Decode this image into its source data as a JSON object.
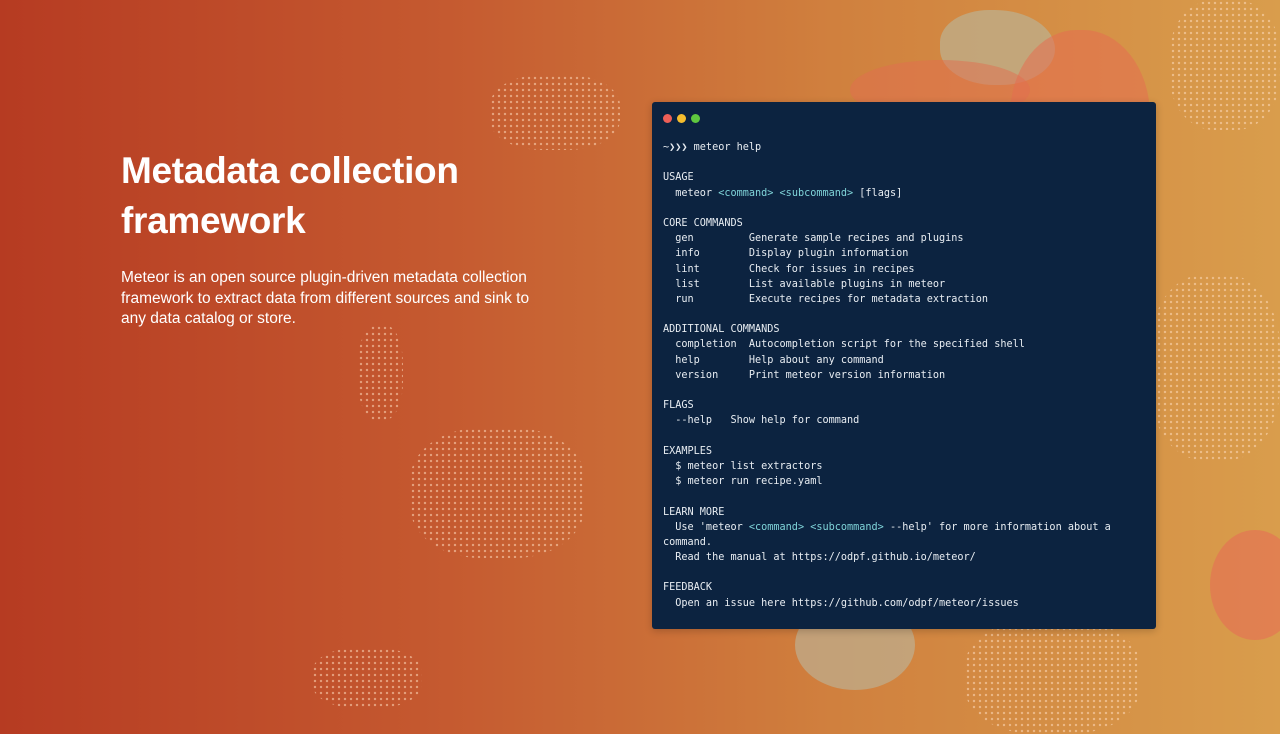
{
  "hero": {
    "title": "Metadata collection framework",
    "description": "Meteor is an open source plugin-driven metadata collection framework to extract data from different sources and sink to any data catalog or store."
  },
  "terminal": {
    "colors": {
      "red": "#ee5f57",
      "yellow": "#f5bd2e",
      "green": "#5fc73f",
      "background": "#0c2340",
      "highlight": "#7fd3d8"
    },
    "lines": [
      [
        {
          "t": "~❯❯❯ meteor help"
        }
      ],
      [],
      [
        {
          "t": "USAGE"
        }
      ],
      [
        {
          "t": "  meteor "
        },
        {
          "t": "<command>",
          "hl": true
        },
        {
          "t": " "
        },
        {
          "t": "<subcommand>",
          "hl": true
        },
        {
          "t": " [flags]"
        }
      ],
      [],
      [
        {
          "t": "CORE COMMANDS"
        }
      ],
      [
        {
          "t": "  gen         Generate sample recipes and plugins"
        }
      ],
      [
        {
          "t": "  info        Display plugin information"
        }
      ],
      [
        {
          "t": "  lint        Check for issues in recipes"
        }
      ],
      [
        {
          "t": "  list        List available plugins in meteor"
        }
      ],
      [
        {
          "t": "  run         Execute recipes for metadata extraction"
        }
      ],
      [],
      [
        {
          "t": "ADDITIONAL COMMANDS"
        }
      ],
      [
        {
          "t": "  completion  Autocompletion script for the specified shell"
        }
      ],
      [
        {
          "t": "  help        Help about any command"
        }
      ],
      [
        {
          "t": "  version     Print meteor version information"
        }
      ],
      [],
      [
        {
          "t": "FLAGS"
        }
      ],
      [
        {
          "t": "  --help   Show help for command"
        }
      ],
      [],
      [
        {
          "t": "EXAMPLES"
        }
      ],
      [
        {
          "t": "  $ meteor list extractors"
        }
      ],
      [
        {
          "t": "  $ meteor run recipe.yaml"
        }
      ],
      [],
      [
        {
          "t": "LEARN MORE"
        }
      ],
      [
        {
          "t": "  Use 'meteor "
        },
        {
          "t": "<command>",
          "hl": true
        },
        {
          "t": " "
        },
        {
          "t": "<subcommand>",
          "hl": true
        },
        {
          "t": " --help' for more information about a"
        }
      ],
      [
        {
          "t": "command."
        }
      ],
      [
        {
          "t": "  Read the manual at https://odpf.github.io/meteor/"
        }
      ],
      [],
      [
        {
          "t": "FEEDBACK"
        }
      ],
      [
        {
          "t": "  Open an issue here https://github.com/odpf/meteor/issues"
        }
      ]
    ]
  }
}
